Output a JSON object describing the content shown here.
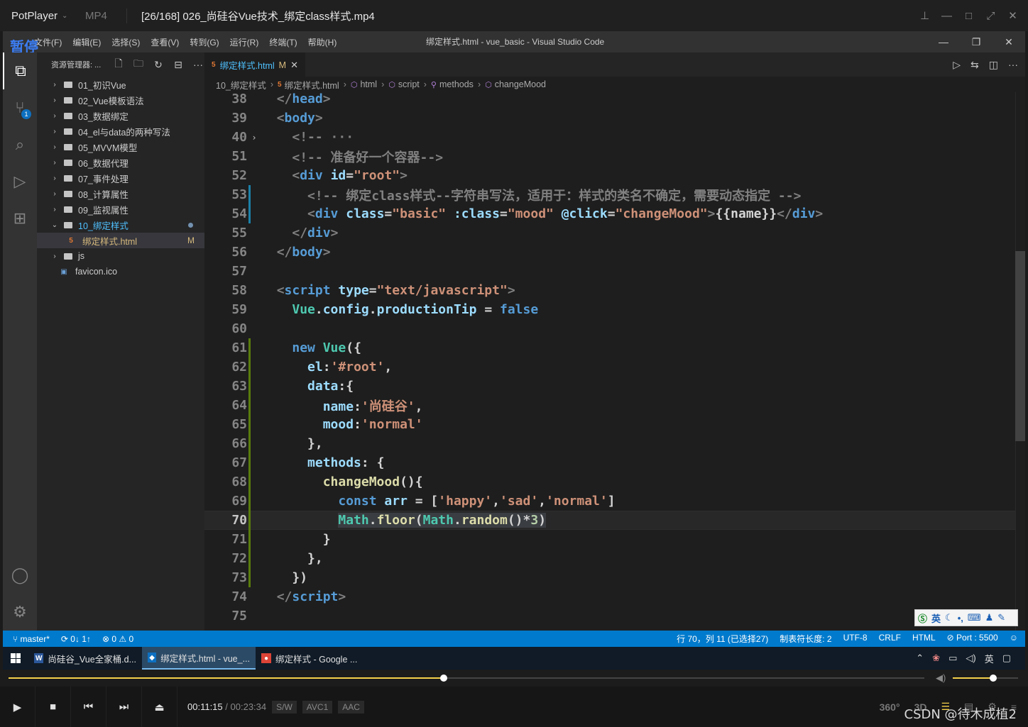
{
  "player": {
    "app_name": "PotPlayer",
    "format": "MP4",
    "file_title": "[26/168] 026_尚硅谷Vue技术_绑定class样式.mp4",
    "pause_label": "暂停",
    "time_current": "00:11:15",
    "time_separator": "/",
    "time_total": "00:23:34",
    "badges": [
      "S/W",
      "AVC1",
      "AAC"
    ],
    "progress": 0.475,
    "volume": 0.62,
    "right_labels": [
      "360°",
      "3D"
    ]
  },
  "vscode": {
    "menu": [
      "文件(F)",
      "编辑(E)",
      "选择(S)",
      "查看(V)",
      "转到(G)",
      "运行(R)",
      "终端(T)",
      "帮助(H)"
    ],
    "window_title": "绑定样式.html - vue_basic - Visual Studio Code",
    "scm_badge": "1",
    "explorer": {
      "title": "资源管理器: ...",
      "items": [
        {
          "label": "01_初识Vue",
          "type": "folder",
          "open": false
        },
        {
          "label": "02_Vue模板语法",
          "type": "folder",
          "open": false
        },
        {
          "label": "03_数据绑定",
          "type": "folder",
          "open": false
        },
        {
          "label": "04_el与data的两种写法",
          "type": "folder",
          "open": false
        },
        {
          "label": "05_MVVM模型",
          "type": "folder",
          "open": false
        },
        {
          "label": "06_数据代理",
          "type": "folder",
          "open": false
        },
        {
          "label": "07_事件处理",
          "type": "folder",
          "open": false
        },
        {
          "label": "08_计算属性",
          "type": "folder",
          "open": false
        },
        {
          "label": "09_监视属性",
          "type": "folder",
          "open": false
        },
        {
          "label": "10_绑定样式",
          "type": "folder",
          "open": true
        },
        {
          "label": "绑定样式.html",
          "type": "html",
          "badge": "M"
        },
        {
          "label": "js",
          "type": "folder",
          "open": false
        },
        {
          "label": "favicon.ico",
          "type": "ico"
        }
      ]
    },
    "tab": {
      "label": "绑定样式.html",
      "modified": "M"
    },
    "breadcrumb": [
      "10_绑定样式",
      "绑定样式.html",
      "html",
      "script",
      "methods",
      "changeMood"
    ],
    "current_line": 70,
    "code_lines": [
      {
        "n": "38",
        "tokens": [
          [
            "  ",
            "t-txt"
          ],
          [
            "</",
            "t-br"
          ],
          [
            "head",
            "t-tag"
          ],
          [
            ">",
            "t-br"
          ]
        ]
      },
      {
        "n": "39",
        "tokens": [
          [
            "  ",
            "t-txt"
          ],
          [
            "<",
            "t-br"
          ],
          [
            "body",
            "t-tag"
          ],
          [
            ">",
            "t-br"
          ]
        ]
      },
      {
        "n": "40",
        "fold": "›",
        "tokens": [
          [
            "    ",
            "t-txt"
          ],
          [
            "<!-- ",
            "t-br"
          ],
          [
            "···",
            "t-br"
          ]
        ]
      },
      {
        "n": "51",
        "tokens": [
          [
            "    ",
            "t-txt"
          ],
          [
            "<!-- 准备好一个容器-->",
            "t-br"
          ]
        ]
      },
      {
        "n": "52",
        "tokens": [
          [
            "    ",
            "t-txt"
          ],
          [
            "<",
            "t-br"
          ],
          [
            "div ",
            "t-tag"
          ],
          [
            "id",
            "t-attr"
          ],
          [
            "=",
            "t-txt"
          ],
          [
            "\"root\"",
            "t-str"
          ],
          [
            ">",
            "t-br"
          ]
        ]
      },
      {
        "n": "53",
        "tokens": [
          [
            "      ",
            "t-txt"
          ],
          [
            "<!-- 绑定class样式--字符串写法，适用于：样式的类名不确定，需要动态指定 -->",
            "t-br"
          ]
        ]
      },
      {
        "n": "54",
        "tokens": [
          [
            "      ",
            "t-txt"
          ],
          [
            "<",
            "t-br"
          ],
          [
            "div ",
            "t-tag"
          ],
          [
            "class",
            "t-attr"
          ],
          [
            "=",
            "t-txt"
          ],
          [
            "\"basic\" ",
            "t-str"
          ],
          [
            ":class",
            "t-attr"
          ],
          [
            "=",
            "t-txt"
          ],
          [
            "\"mood\" ",
            "t-str"
          ],
          [
            "@click",
            "t-attr"
          ],
          [
            "=",
            "t-txt"
          ],
          [
            "\"changeMood\"",
            "t-str"
          ],
          [
            ">",
            "t-br"
          ],
          [
            "{{name}}",
            "t-txt"
          ],
          [
            "</",
            "t-br"
          ],
          [
            "div",
            "t-tag"
          ],
          [
            ">",
            "t-br"
          ]
        ]
      },
      {
        "n": "55",
        "tokens": [
          [
            "    ",
            "t-txt"
          ],
          [
            "</",
            "t-br"
          ],
          [
            "div",
            "t-tag"
          ],
          [
            ">",
            "t-br"
          ]
        ]
      },
      {
        "n": "56",
        "tokens": [
          [
            "  ",
            "t-txt"
          ],
          [
            "</",
            "t-br"
          ],
          [
            "body",
            "t-tag"
          ],
          [
            ">",
            "t-br"
          ]
        ]
      },
      {
        "n": "57",
        "tokens": []
      },
      {
        "n": "58",
        "tokens": [
          [
            "  ",
            "t-txt"
          ],
          [
            "<",
            "t-br"
          ],
          [
            "script ",
            "t-tag"
          ],
          [
            "type",
            "t-attr"
          ],
          [
            "=",
            "t-txt"
          ],
          [
            "\"text/javascript\"",
            "t-str"
          ],
          [
            ">",
            "t-br"
          ]
        ]
      },
      {
        "n": "59",
        "tokens": [
          [
            "    ",
            "t-txt"
          ],
          [
            "Vue",
            "t-cls"
          ],
          [
            ".",
            "t-txt"
          ],
          [
            "config",
            "t-var"
          ],
          [
            ".",
            "t-txt"
          ],
          [
            "productionTip",
            "t-var"
          ],
          [
            " = ",
            "t-txt"
          ],
          [
            "false",
            "t-kw"
          ]
        ]
      },
      {
        "n": "60",
        "tokens": []
      },
      {
        "n": "61",
        "tokens": [
          [
            "    ",
            "t-txt"
          ],
          [
            "new ",
            "t-kw"
          ],
          [
            "Vue",
            "t-cls"
          ],
          [
            "({",
            "t-txt"
          ]
        ]
      },
      {
        "n": "62",
        "tokens": [
          [
            "      ",
            "t-txt"
          ],
          [
            "el",
            "t-var"
          ],
          [
            ":",
            "t-txt"
          ],
          [
            "'#root'",
            "t-str"
          ],
          [
            ",",
            "t-txt"
          ]
        ]
      },
      {
        "n": "63",
        "tokens": [
          [
            "      ",
            "t-txt"
          ],
          [
            "data",
            "t-var"
          ],
          [
            ":{",
            "t-txt"
          ]
        ]
      },
      {
        "n": "64",
        "tokens": [
          [
            "        ",
            "t-txt"
          ],
          [
            "name",
            "t-var"
          ],
          [
            ":",
            "t-txt"
          ],
          [
            "'尚硅谷'",
            "t-str"
          ],
          [
            ",",
            "t-txt"
          ]
        ]
      },
      {
        "n": "65",
        "tokens": [
          [
            "        ",
            "t-txt"
          ],
          [
            "mood",
            "t-var"
          ],
          [
            ":",
            "t-txt"
          ],
          [
            "'normal'",
            "t-str"
          ]
        ]
      },
      {
        "n": "66",
        "tokens": [
          [
            "      ",
            "t-txt"
          ],
          [
            "},",
            "t-txt"
          ]
        ]
      },
      {
        "n": "67",
        "tokens": [
          [
            "      ",
            "t-txt"
          ],
          [
            "methods",
            "t-var"
          ],
          [
            ": {",
            "t-txt"
          ]
        ]
      },
      {
        "n": "68",
        "tokens": [
          [
            "        ",
            "t-txt"
          ],
          [
            "changeMood",
            "t-fn"
          ],
          [
            "(){",
            "t-txt"
          ]
        ]
      },
      {
        "n": "69",
        "tokens": [
          [
            "          ",
            "t-txt"
          ],
          [
            "const ",
            "t-kw"
          ],
          [
            "arr",
            "t-var"
          ],
          [
            " = [",
            "t-txt"
          ],
          [
            "'happy'",
            "t-str"
          ],
          [
            ",",
            "t-txt"
          ],
          [
            "'sad'",
            "t-str"
          ],
          [
            ",",
            "t-txt"
          ],
          [
            "'normal'",
            "t-str"
          ],
          [
            "]",
            "t-txt"
          ]
        ]
      },
      {
        "n": "70",
        "tokens": [
          [
            "          ",
            "t-txt"
          ],
          [
            "Math",
            "t-cls",
            "sel"
          ],
          [
            ".",
            "t-txt",
            "sel"
          ],
          [
            "floor",
            "t-fn",
            "sel"
          ],
          [
            "(",
            "t-txt",
            "sel"
          ],
          [
            "Math",
            "t-cls",
            "sel"
          ],
          [
            ".",
            "t-txt",
            "sel"
          ],
          [
            "random",
            "t-fn",
            "sel"
          ],
          [
            "()*",
            "t-txt",
            "sel"
          ],
          [
            "3",
            "t-num",
            "sel"
          ],
          [
            ")",
            "t-txt",
            "sel"
          ]
        ]
      },
      {
        "n": "71",
        "tokens": [
          [
            "        ",
            "t-txt"
          ],
          [
            "}",
            "t-txt"
          ]
        ]
      },
      {
        "n": "72",
        "tokens": [
          [
            "      ",
            "t-txt"
          ],
          [
            "},",
            "t-txt"
          ]
        ]
      },
      {
        "n": "73",
        "tokens": [
          [
            "    ",
            "t-txt"
          ],
          [
            "})",
            "t-txt"
          ]
        ]
      },
      {
        "n": "74",
        "tokens": [
          [
            "  ",
            "t-txt"
          ],
          [
            "</",
            "t-br"
          ],
          [
            "script",
            "t-tag"
          ],
          [
            ">",
            "t-br"
          ]
        ]
      },
      {
        "n": "75",
        "tokens": []
      }
    ],
    "status": {
      "branch": "master*",
      "sync": "0↓ 1↑",
      "problems": "⊗ 0 ⚠ 0",
      "position": "行 70，列 11 (已选择27)",
      "tab_size": "制表符长度: 2",
      "encoding": "UTF-8",
      "eol": "CRLF",
      "language": "HTML",
      "port": "Port : 5500"
    },
    "ime_label": "英"
  },
  "taskbar": {
    "apps": [
      {
        "label": "尚硅谷_Vue全家桶.d...",
        "icon": "W",
        "color": "#2b579a",
        "active": false
      },
      {
        "label": "绑定样式.html - vue_...",
        "icon": "◆",
        "color": "#0e70c0",
        "active": true
      },
      {
        "label": "绑定样式 - Google ...",
        "icon": "●",
        "color": "#db4437",
        "active": false
      }
    ],
    "tray_lang": "英"
  },
  "watermark": "CSDN @待木成植2"
}
